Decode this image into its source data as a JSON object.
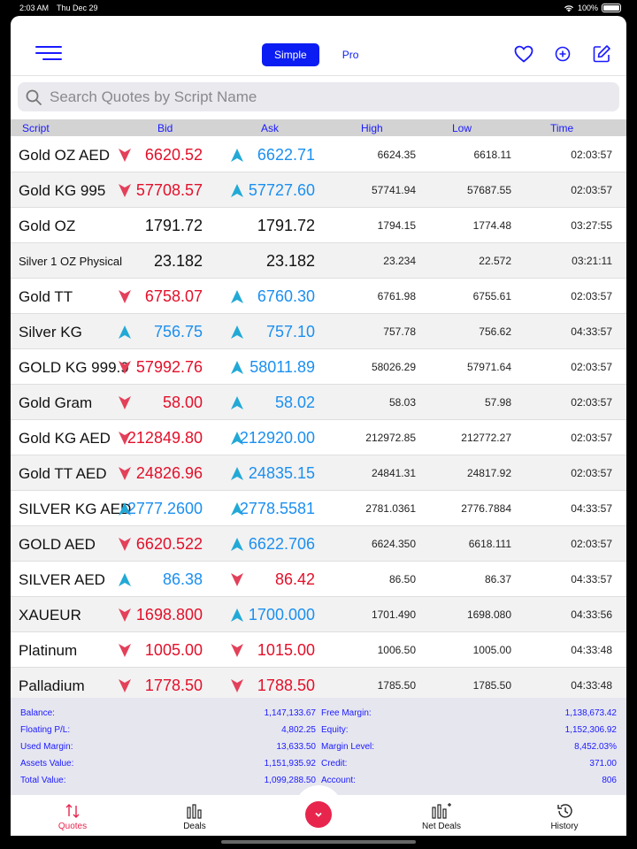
{
  "status": {
    "time": "2:03 AM",
    "date": "Thu Dec 29",
    "battery": "100%"
  },
  "header": {
    "tab_simple": "Simple",
    "tab_pro": "Pro"
  },
  "search": {
    "placeholder": "Search Quotes by Script Name"
  },
  "columns": {
    "script": "Script",
    "bid": "Bid",
    "ask": "Ask",
    "high": "High",
    "low": "Low",
    "time": "Time"
  },
  "quotes": [
    {
      "name": "Gold OZ AED",
      "bid": "6620.52",
      "bid_dir": "down",
      "ask": "6622.71",
      "ask_dir": "up",
      "high": "6624.35",
      "low": "6618.11",
      "time": "02:03:57"
    },
    {
      "name": "Gold KG 995",
      "bid": "57708.57",
      "bid_dir": "down",
      "ask": "57727.60",
      "ask_dir": "up",
      "high": "57741.94",
      "low": "57687.55",
      "time": "02:03:57"
    },
    {
      "name": "Gold OZ",
      "bid": "1791.72",
      "bid_dir": "none",
      "ask": "1791.72",
      "ask_dir": "none",
      "high": "1794.15",
      "low": "1774.48",
      "time": "03:27:55"
    },
    {
      "name": "Silver 1 OZ Physical",
      "bid": "23.182",
      "bid_dir": "none",
      "ask": "23.182",
      "ask_dir": "none",
      "high": "23.234",
      "low": "22.572",
      "time": "03:21:11"
    },
    {
      "name": "Gold TT",
      "bid": "6758.07",
      "bid_dir": "down",
      "ask": "6760.30",
      "ask_dir": "up",
      "high": "6761.98",
      "low": "6755.61",
      "time": "02:03:57"
    },
    {
      "name": "Silver KG",
      "bid": "756.75",
      "bid_dir": "up",
      "ask": "757.10",
      "ask_dir": "up",
      "high": "757.78",
      "low": "756.62",
      "time": "04:33:57"
    },
    {
      "name": "GOLD KG 999.9",
      "bid": "57992.76",
      "bid_dir": "down",
      "ask": "58011.89",
      "ask_dir": "up",
      "high": "58026.29",
      "low": "57971.64",
      "time": "02:03:57"
    },
    {
      "name": "Gold Gram",
      "bid": "58.00",
      "bid_dir": "down",
      "ask": "58.02",
      "ask_dir": "up",
      "high": "58.03",
      "low": "57.98",
      "time": "02:03:57"
    },
    {
      "name": "Gold KG AED",
      "bid": "212849.80",
      "bid_dir": "down",
      "ask": "212920.00",
      "ask_dir": "up",
      "high": "212972.85",
      "low": "212772.27",
      "time": "02:03:57"
    },
    {
      "name": "Gold TT AED",
      "bid": "24826.96",
      "bid_dir": "down",
      "ask": "24835.15",
      "ask_dir": "up",
      "high": "24841.31",
      "low": "24817.92",
      "time": "02:03:57"
    },
    {
      "name": "SILVER KG AED",
      "bid": "2777.2600",
      "bid_dir": "up",
      "ask": "2778.5581",
      "ask_dir": "up",
      "high": "2781.0361",
      "low": "2776.7884",
      "time": "04:33:57"
    },
    {
      "name": "GOLD AED",
      "bid": "6620.522",
      "bid_dir": "down",
      "ask": "6622.706",
      "ask_dir": "up",
      "high": "6624.350",
      "low": "6618.111",
      "time": "02:03:57"
    },
    {
      "name": "SILVER AED",
      "bid": "86.38",
      "bid_dir": "up",
      "ask": "86.42",
      "ask_dir": "down",
      "high": "86.50",
      "low": "86.37",
      "time": "04:33:57"
    },
    {
      "name": "XAUEUR",
      "bid": "1698.800",
      "bid_dir": "down",
      "ask": "1700.000",
      "ask_dir": "up",
      "high": "1701.490",
      "low": "1698.080",
      "time": "04:33:56"
    },
    {
      "name": "Platinum",
      "bid": "1005.00",
      "bid_dir": "down",
      "ask": "1015.00",
      "ask_dir": "down",
      "high": "1006.50",
      "low": "1005.00",
      "time": "04:33:48"
    },
    {
      "name": "Palladium",
      "bid": "1778.50",
      "bid_dir": "down",
      "ask": "1788.50",
      "ask_dir": "down",
      "high": "1785.50",
      "low": "1785.50",
      "time": "04:33:48"
    }
  ],
  "account_left": [
    {
      "label": "Balance:",
      "value": "1,147,133.67"
    },
    {
      "label": "Floating P/L:",
      "value": "4,802.25"
    },
    {
      "label": "Used Margin:",
      "value": "13,633.50"
    },
    {
      "label": "Assets Value:",
      "value": "1,151,935.92"
    },
    {
      "label": "Total Value:",
      "value": "1,099,288.50"
    }
  ],
  "account_right": [
    {
      "label": "Free Margin:",
      "value": "1,138,673.42"
    },
    {
      "label": "Equity:",
      "value": "1,152,306.92"
    },
    {
      "label": "Margin Level:",
      "value": "8,452.03%"
    },
    {
      "label": "Credit:",
      "value": "371.00"
    },
    {
      "label": "Account:",
      "value": "806"
    }
  ],
  "tabs": {
    "quotes": "Quotes",
    "deals": "Deals",
    "net_deals": "Net Deals",
    "history": "History"
  },
  "colors": {
    "accent": "#0b1df2",
    "up": "#1b8ff0",
    "down": "#e3102a",
    "active_tab": "#e8254d"
  }
}
